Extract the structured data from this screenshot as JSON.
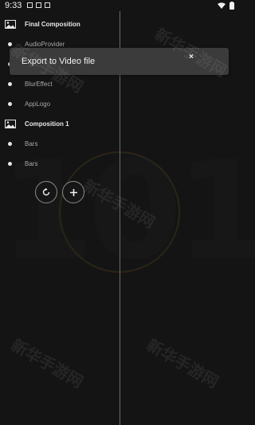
{
  "status_bar": {
    "time": "9:33",
    "left_icons": [
      "notification-square-icon",
      "notification-square-icon",
      "notification-square-icon"
    ],
    "right_icons": [
      "wifi-icon",
      "battery-icon"
    ]
  },
  "layers": [
    {
      "type": "composition",
      "label": "Final Composition",
      "icon": "image-composition-icon"
    },
    {
      "type": "layer",
      "label": "AudioProvider",
      "icon": "bullet-icon"
    },
    {
      "type": "layer",
      "label": "",
      "icon": "bullet-icon"
    },
    {
      "type": "layer",
      "label": "BlurEffect",
      "icon": "bullet-icon"
    },
    {
      "type": "layer",
      "label": "AppLogo",
      "icon": "bullet-icon"
    },
    {
      "type": "composition",
      "label": "Composition 1",
      "icon": "image-composition-icon"
    },
    {
      "type": "layer",
      "label": "Bars",
      "icon": "bullet-icon"
    },
    {
      "type": "layer",
      "label": "Bars",
      "icon": "bullet-icon"
    }
  ],
  "controls": {
    "reset_icon": "refresh-icon",
    "add_icon": "plus-icon"
  },
  "toast": {
    "message": "Export to Video file",
    "close_glyph": "×"
  },
  "preview": {
    "background_digits": "101"
  },
  "watermark": {
    "text": "新华手游网"
  }
}
